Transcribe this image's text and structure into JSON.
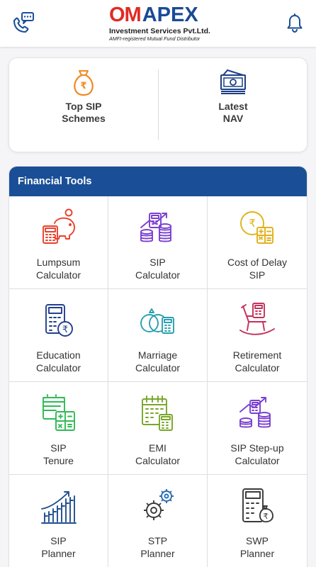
{
  "header": {
    "logo_om": "OM",
    "logo_apex": "APEX",
    "logo_subtitle": "Investment Services Pvt.Ltd.",
    "logo_tagline": "AMFI-registered Mutual Fund Distributor",
    "contact_icon": "phone-chat-icon",
    "notification_icon": "bell-icon"
  },
  "quick_links": [
    {
      "label": "Top SIP\nSchemes",
      "icon": "money-bag-icon"
    },
    {
      "label": "Latest\nNAV",
      "icon": "cash-stack-icon"
    }
  ],
  "financial_tools": {
    "title": "Financial Tools",
    "items": [
      {
        "label": "Lumpsum\nCalculator",
        "icon": "piggy-bank-calculator-icon",
        "color": "#e8412c"
      },
      {
        "label": "SIP\nCalculator",
        "icon": "calculator-coins-growth-icon",
        "color": "#7a3fd1"
      },
      {
        "label": "Cost of Delay\nSIP",
        "icon": "rupee-coin-calculator-icon",
        "color": "#e2b11c"
      },
      {
        "label": "Education\nCalculator",
        "icon": "calculator-rupee-icon",
        "color": "#233f8e"
      },
      {
        "label": "Marriage\nCalculator",
        "icon": "rings-calculator-icon",
        "color": "#2a9fb0"
      },
      {
        "label": "Retirement\nCalculator",
        "icon": "rocking-chair-calculator-icon",
        "color": "#c4305a"
      },
      {
        "label": "SIP\nTenure",
        "icon": "calendar-calculator-icon",
        "color": "#2fba55"
      },
      {
        "label": "EMI\nCalculator",
        "icon": "calendar-grid-calculator-icon",
        "color": "#7aa629"
      },
      {
        "label": "SIP Step-up\nCalculator",
        "icon": "coins-stepup-calculator-icon",
        "color": "#7a3fd1"
      },
      {
        "label": "SIP\nPlanner",
        "icon": "bar-growth-arrow-icon",
        "color": "#1f4f8f"
      },
      {
        "label": "STP\nPlanner",
        "icon": "gears-icon",
        "color": "#3a3a3a"
      },
      {
        "label": "SWP\nPlanner",
        "icon": "calculator-moneybag-icon",
        "color": "#3a3a3a"
      }
    ]
  }
}
